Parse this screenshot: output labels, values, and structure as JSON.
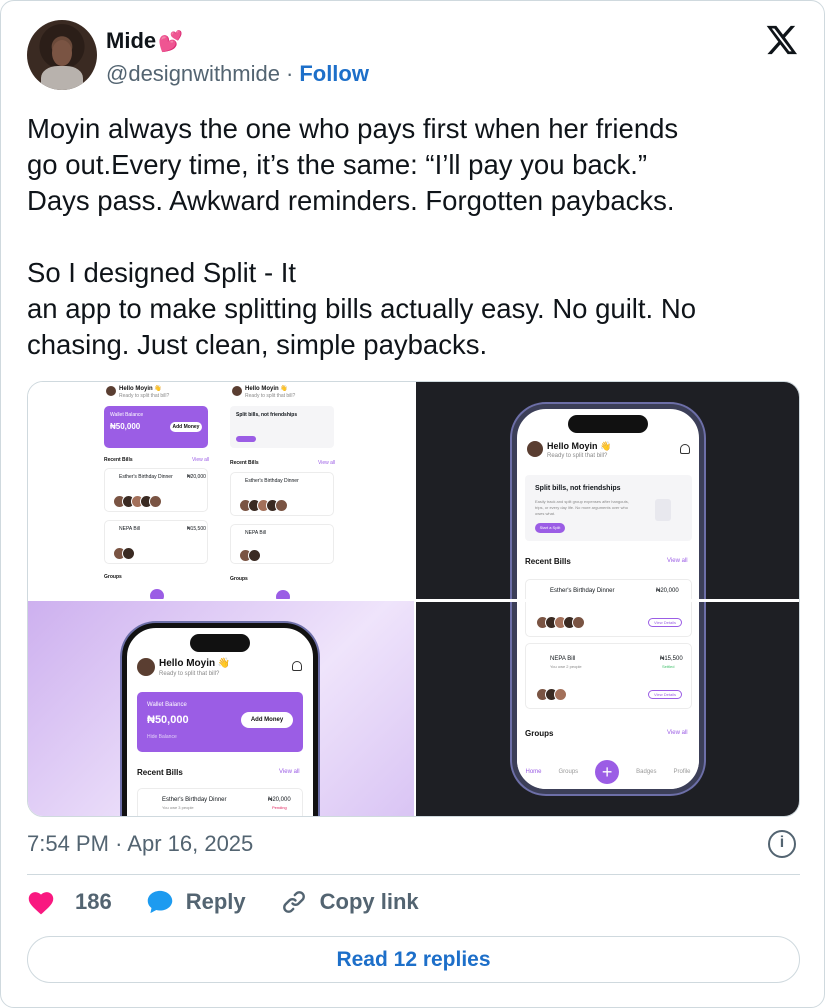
{
  "author": {
    "name": "Mide",
    "name_emoji": "💕",
    "handle": "@designwithmide",
    "separator": "·",
    "follow_label": "Follow"
  },
  "tweet": {
    "text": "Moyin always the one who pays first when her friends\ngo out.Every time, it’s the same: “I’ll pay you back.”\nDays pass. Awkward reminders. Forgotten paybacks.\n\nSo I designed Split - It\nan app to make splitting bills actually easy. No guilt. No\nchasing. Just clean, simple paybacks."
  },
  "media": {
    "app": {
      "greeting": "Hello Moyin 👋",
      "sub": "Ready to split that bill?",
      "split_title": "Split bills, not friendships",
      "split_desc": "Easily track and split group expenses after hangouts, trips, or every day life. No more arguments over who owes what.",
      "split_button": "Start a Split",
      "wallet_label": "Wallet Balance",
      "wallet_amount": "₦50,000",
      "add_money": "Add Money",
      "hide_balance": "Hide Balance",
      "recent_bills": "Recent Bills",
      "view_all": "View all",
      "groups": "Groups",
      "bills": [
        {
          "title": "Esther's Birthday Dinner",
          "sub": "You owe 3 people",
          "amount": "₦20,000",
          "status": "Pending",
          "action": "View Details"
        },
        {
          "title": "NEPA Bill",
          "sub": "You owe 2 people",
          "amount": "₦15,500",
          "status": "Settled",
          "action": "View Details"
        }
      ],
      "nav": [
        "Home",
        "Groups",
        "Badges",
        "Profile"
      ]
    },
    "colors": {
      "accent": "#9b5de5",
      "dark_bg": "#1e1f24"
    }
  },
  "meta": {
    "time": "7:54 PM",
    "separator": "·",
    "date": "Apr 16, 2025"
  },
  "actions": {
    "likes": "186",
    "reply_label": "Reply",
    "copy_label": "Copy link",
    "read_replies": "Read 12 replies"
  },
  "icons": [
    "x-logo-icon",
    "info-icon",
    "heart-icon",
    "reply-bubble-icon",
    "link-icon",
    "bell-icon",
    "plus-icon"
  ]
}
